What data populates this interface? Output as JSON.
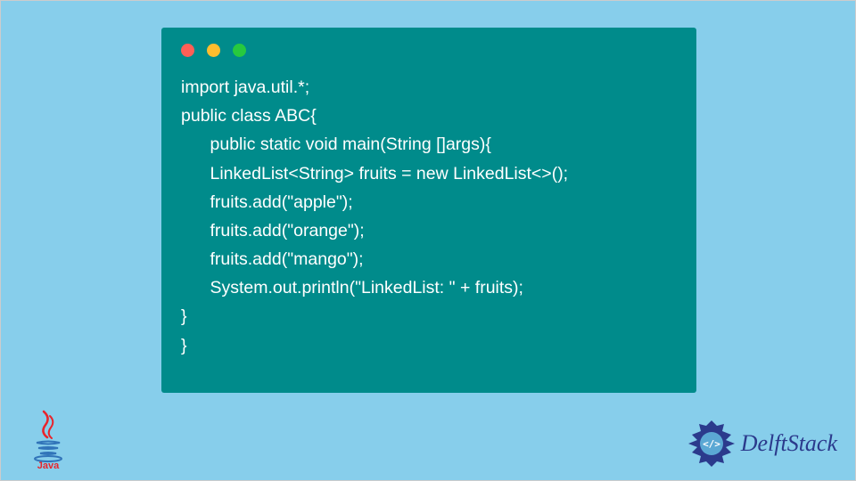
{
  "code": {
    "lines": [
      "import java.util.*;",
      "public class ABC{",
      "      public static void main(String []args){",
      "      LinkedList<String> fruits = new LinkedList<>();",
      "      fruits.add(\"apple\");",
      "      fruits.add(\"orange\");",
      "      fruits.add(\"mango\");",
      "      System.out.println(\"LinkedList: \" + fruits);",
      "}",
      "}"
    ]
  },
  "logos": {
    "java_label": "Java",
    "delft_label": "DelftStack"
  }
}
